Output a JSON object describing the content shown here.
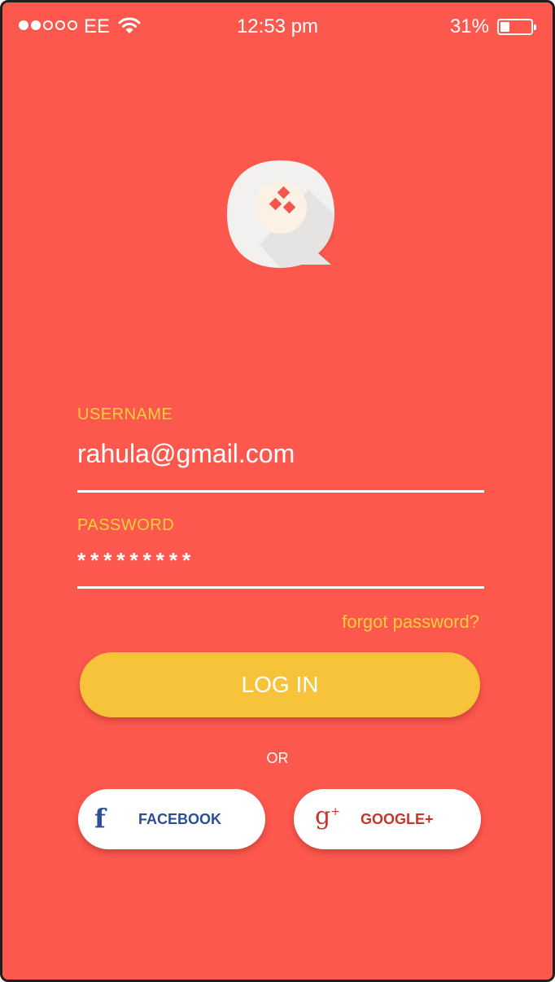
{
  "status_bar": {
    "signal_filled": 2,
    "signal_total": 5,
    "carrier": "EE",
    "wifi_icon": "wifi-icon",
    "time": "12:53 pm",
    "battery_percent": "31%",
    "battery_level": 0.31
  },
  "logo": {
    "icon": "chat-bubble-logo-icon"
  },
  "form": {
    "username_label": "USERNAME",
    "username_value": "rahula@gmail.com",
    "password_label": "PASSWORD",
    "password_value": "*********",
    "forgot_password": "forgot password?",
    "login_button": "LOG IN",
    "or_text": "OR"
  },
  "social": {
    "facebook_icon": "facebook-icon",
    "facebook_label": "FACEBOOK",
    "google_icon": "google-plus-icon",
    "google_label": "GOOGLE+"
  },
  "colors": {
    "background": "#fd584e",
    "label_yellow": "#fbcf3c",
    "login_button": "#f6c33a",
    "facebook_blue": "#2b4e95",
    "google_red": "#c2362b",
    "white": "#ffffff"
  }
}
